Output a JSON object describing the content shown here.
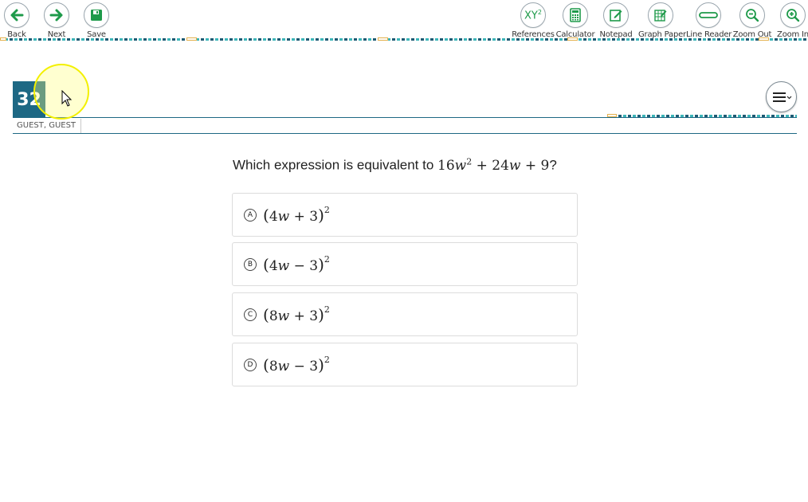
{
  "toolbar": {
    "left": [
      {
        "label": "Back",
        "icon": "arrow-left-icon"
      },
      {
        "label": "Next",
        "icon": "arrow-right-icon"
      },
      {
        "label": "Save",
        "icon": "floppy-disk-icon"
      }
    ],
    "right": [
      {
        "label": "References",
        "icon": "references-icon",
        "icon_text": "XY",
        "icon_sup": "2"
      },
      {
        "label": "Calculator",
        "icon": "calculator-icon"
      },
      {
        "label": "Notepad",
        "icon": "notepad-icon"
      },
      {
        "label": "Graph Paper",
        "icon": "graph-paper-icon"
      },
      {
        "label": "Line Reader",
        "icon": "line-reader-icon"
      },
      {
        "label": "Zoom Out",
        "icon": "zoom-out-icon"
      },
      {
        "label": "Zoom In",
        "icon": "zoom-in-icon"
      }
    ]
  },
  "question": {
    "number": "32",
    "user": "GUEST, GUEST",
    "stem_text": "Which expression is equivalent to ",
    "stem_math_a": "16",
    "stem_var": "w",
    "stem_exp": "2",
    "stem_math_b": " + 24",
    "stem_math_c": " + 9",
    "stem_end": "?",
    "choices": [
      {
        "letter": "A",
        "coef": "4",
        "var": "w",
        "op": "+",
        "const": "3",
        "exp": "2"
      },
      {
        "letter": "B",
        "coef": "4",
        "var": "w",
        "op": "−",
        "const": "3",
        "exp": "2"
      },
      {
        "letter": "C",
        "coef": "8",
        "var": "w",
        "op": "+",
        "const": "3",
        "exp": "2"
      },
      {
        "letter": "D",
        "coef": "8",
        "var": "w",
        "op": "−",
        "const": "3",
        "exp": "2"
      }
    ]
  },
  "colors": {
    "accent": "#1d6884",
    "icon_green": "#1e9a4a",
    "dash_dark": "#1d5a73",
    "dash_light": "#3cb5b8",
    "highlight": "#f3f000"
  }
}
